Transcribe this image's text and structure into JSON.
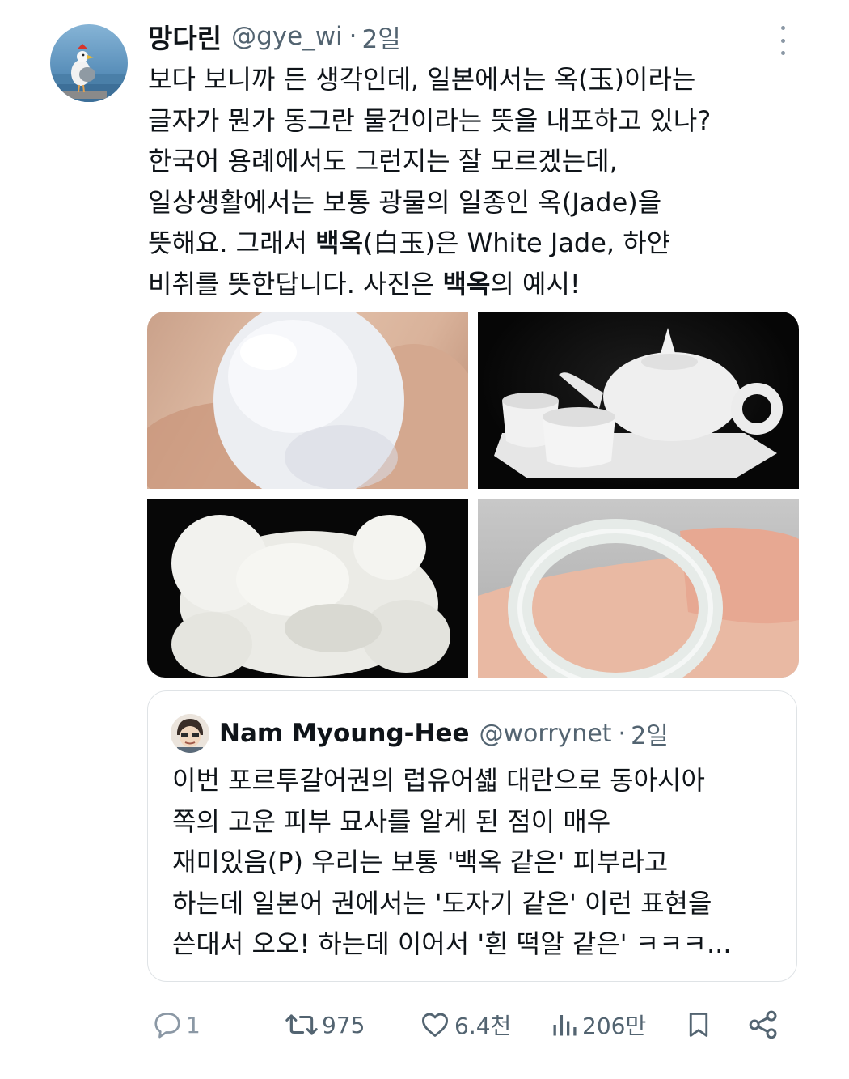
{
  "tweet": {
    "author_name": "망다린",
    "author_handle": "@gye_wi",
    "time": "2일",
    "lines": [
      "보다 보니까 든 생각인데, 일본에서는 옥(玉)이라는",
      "글자가 뭔가 동그란 물건이라는 뜻을 내포하고 있나?",
      "한국어 용례에서도 그런지는 잘 모르겠는데,",
      "일상생활에서는 보통 광물의 일종인 옥(Jade)을",
      {
        "a": "뜻해요. 그래서 ",
        "b": "백옥",
        "c": "(白玉)은 White Jade, 하얀"
      },
      {
        "a": "비취를 뜻한답니다. 사진은 ",
        "b": "백옥",
        "c": "의 예시!"
      }
    ]
  },
  "media": [
    {
      "subject": "white jade oval cabochon held between fingers"
    },
    {
      "subject": "white jade teapot and cups set"
    },
    {
      "subject": "white jade carved lion figurine"
    },
    {
      "subject": "white jade bangle on wrist"
    }
  ],
  "quote": {
    "author_name": "Nam Myoung-Hee",
    "author_handle": "@worrynet",
    "time": "2일",
    "lines": [
      "이번 포르투갈어권의 럽유어셻 대란으로 동아시아",
      "쪽의 고운 피부 묘사를 알게 된 점이 매우",
      "재미있음(P) 우리는 보통 '백옥 같은' 피부라고",
      "하는데 일본어 권에서는 '도자기 같은' 이런 표현을",
      "쓴대서 오오! 하는데 이어서 '흰 떡알 같은' ㅋㅋㅋ..."
    ]
  },
  "actions": {
    "reply_count": "1",
    "retweet_count": "975",
    "like_count": "6.4천",
    "views_count": "206만"
  },
  "colors": {
    "text": "#0f1419",
    "secondary": "#536471",
    "border": "#dfe3e6"
  },
  "icons": [
    "more-icon",
    "reply-icon",
    "retweet-icon",
    "like-icon",
    "views-icon",
    "bookmark-icon",
    "share-icon"
  ]
}
